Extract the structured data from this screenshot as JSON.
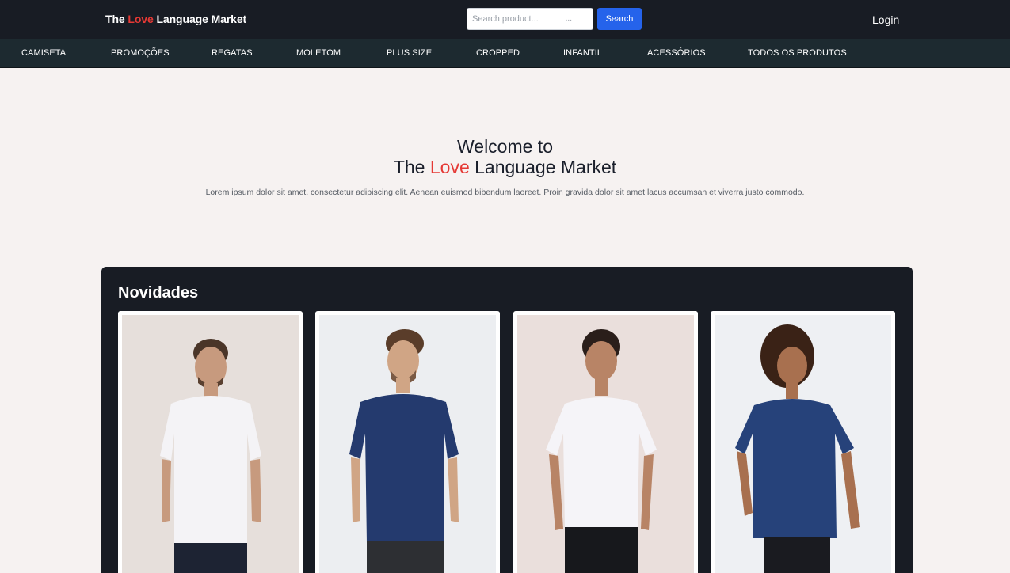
{
  "header": {
    "brand_prefix": "The ",
    "brand_accent": "Love",
    "brand_suffix": " Language Market",
    "search_placeholder": "Search product...",
    "search_ellipsis": "...",
    "search_button": "Search",
    "login": "Login"
  },
  "categories": [
    "CAMISETA",
    "PROMOÇÕES",
    "REGATAS",
    "MOLETOM",
    "PLUS SIZE",
    "CROPPED",
    "INFANTIL",
    "ACESSÓRIOS",
    "TODOS OS PRODUTOS"
  ],
  "hero": {
    "line1": "Welcome to",
    "line2_prefix": "The ",
    "line2_accent": "Love",
    "line2_suffix": " Language Market",
    "subtitle": "Lorem ipsum dolor sit amet, consectetur adipiscing elit. Aenean euismod bibendum laoreet. Proin gravida dolor sit amet lacus accumsan et viverra justo commodo."
  },
  "news": {
    "title": "Novidades"
  },
  "colors": {
    "accent_red": "#e53935",
    "search_blue": "#2563eb",
    "dark": "#181c24",
    "catbar": "#1d2a30",
    "page_bg": "#f6f2f1"
  }
}
